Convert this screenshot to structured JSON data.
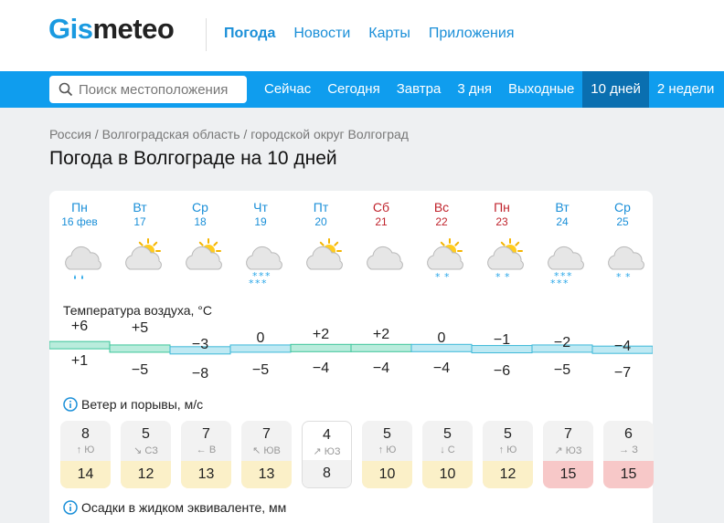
{
  "header": {
    "logo_part1": "Gis",
    "logo_part2": "meteo",
    "nav": [
      "Погода",
      "Новости",
      "Карты",
      "Приложения"
    ]
  },
  "bar": {
    "search_placeholder": "Поиск местоположения",
    "tabs": [
      "Сейчас",
      "Сегодня",
      "Завтра",
      "3 дня",
      "Выходные",
      "10 дней",
      "2 недели"
    ],
    "active_tab": "10 дней"
  },
  "breadcrumb": "Россия / Волгоградская область / городской округ Волгоград",
  "page_title": "Погода в Волгограде на 10 дней",
  "days": [
    {
      "name": "Пн",
      "date": "16 фев",
      "weekend": false,
      "icon": "cloud-rain-icon"
    },
    {
      "name": "Вт",
      "date": "17",
      "weekend": false,
      "icon": "partly-cloudy-icon"
    },
    {
      "name": "Ср",
      "date": "18",
      "weekend": false,
      "icon": "partly-cloudy-icon"
    },
    {
      "name": "Чт",
      "date": "19",
      "weekend": false,
      "icon": "cloud-snow-icon"
    },
    {
      "name": "Пт",
      "date": "20",
      "weekend": false,
      "icon": "partly-cloudy-icon"
    },
    {
      "name": "Сб",
      "date": "21",
      "weekend": true,
      "icon": "cloud-icon"
    },
    {
      "name": "Вс",
      "date": "22",
      "weekend": true,
      "icon": "partly-cloudy-snow-icon"
    },
    {
      "name": "Пн",
      "date": "23",
      "weekend": true,
      "icon": "partly-cloudy-snow-icon"
    },
    {
      "name": "Вт",
      "date": "24",
      "weekend": false,
      "icon": "cloud-snow-icon"
    },
    {
      "name": "Ср",
      "date": "25",
      "weekend": false,
      "icon": "cloud-snow-light-icon"
    }
  ],
  "temperature": {
    "label": "Температура воздуха, °C",
    "max": [
      "+6",
      "+5",
      "−3",
      "0",
      "+2",
      "+2",
      "0",
      "−1",
      "−2",
      "−4"
    ],
    "min": [
      "+1",
      "−5",
      "−8",
      "−5",
      "−4",
      "−4",
      "−4",
      "−6",
      "−5",
      "−7"
    ]
  },
  "wind": {
    "label": "Ветер и порывы, м/с",
    "speed": [
      "8",
      "5",
      "7",
      "7",
      "4",
      "5",
      "5",
      "5",
      "7",
      "6"
    ],
    "direction": [
      "Ю",
      "СЗ",
      "В",
      "ЮВ",
      "ЮЗ",
      "Ю",
      "С",
      "Ю",
      "ЮЗ",
      "З"
    ],
    "arrows": [
      "↑",
      "↘",
      "←",
      "↖",
      "↗",
      "↑",
      "↓",
      "↑",
      "↗",
      "→"
    ],
    "gusts": [
      "14",
      "12",
      "13",
      "13",
      "8",
      "10",
      "10",
      "12",
      "15",
      "15"
    ],
    "gust_level": [
      "yellow",
      "yellow",
      "yellow",
      "yellow",
      "neutral",
      "yellow",
      "yellow",
      "yellow",
      "red",
      "red"
    ]
  },
  "precip": {
    "label": "Осадки в жидком эквиваленте, мм"
  },
  "colors": {
    "accent": "#1a8fd8",
    "bar": "#0f9dee",
    "active_tab": "#0a6fb0",
    "weekend": "#c0232c"
  }
}
